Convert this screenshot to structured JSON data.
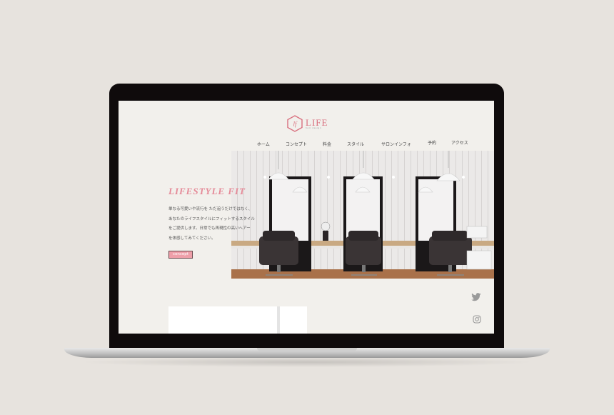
{
  "brand": {
    "name": "LIFE",
    "subtitle": "hair design",
    "monogram": "lf",
    "accent": "#d9707f"
  },
  "nav": {
    "items": [
      {
        "label": "ホーム"
      },
      {
        "label": "コンセプト"
      },
      {
        "label": "料金"
      },
      {
        "label": "スタイル"
      },
      {
        "label": "サロンインフォ"
      },
      {
        "label": "予約"
      },
      {
        "label": "アクセス"
      }
    ]
  },
  "hero": {
    "title": "LIFESTYLE FIT",
    "lines": [
      "単なる可愛いや流行を ただ追うだけではなく、",
      "あなたのライフスタイルにフィットするスタイル",
      "をご提供します。日常でも再現性の高いヘアー",
      "を体感してみてください。"
    ],
    "button_label": "concept",
    "photo_icon": "salon-interior-image"
  },
  "social": {
    "twitter_icon": "twitter-icon",
    "instagram_icon": "instagram-icon"
  },
  "colors": {
    "background": "#e7e3de",
    "screen": "#f2f0ec",
    "title_pink": "#e58a98",
    "button_pink": "#ee9fa9"
  }
}
